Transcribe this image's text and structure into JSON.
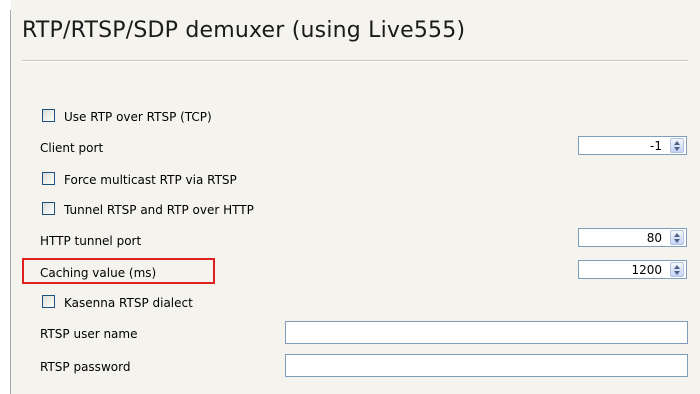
{
  "title": "RTP/RTSP/SDP demuxer (using Live555)",
  "options": {
    "use_rtp_over_rtsp": {
      "label": "Use RTP over RTSP (TCP)",
      "checked": false
    },
    "client_port": {
      "label": "Client port",
      "value": "-1"
    },
    "force_multicast": {
      "label": "Force multicast RTP via RTSP",
      "checked": false
    },
    "tunnel_rtsp_http": {
      "label": "Tunnel RTSP and RTP over HTTP",
      "checked": false
    },
    "http_tunnel_port": {
      "label": "HTTP tunnel port",
      "value": "80"
    },
    "caching_value": {
      "label": "Caching value (ms)",
      "value": "1200"
    },
    "kasenna_dialect": {
      "label": "Kasenna RTSP dialect",
      "checked": false
    },
    "rtsp_user_name": {
      "label": "RTSP user name",
      "value": ""
    },
    "rtsp_password": {
      "label": "RTSP password",
      "value": ""
    }
  },
  "colors": {
    "panel_bg": "#f4f3ee",
    "highlight": "#e0201f",
    "input_border": "#7f9db9",
    "checkbox_border": "#1c5180"
  }
}
